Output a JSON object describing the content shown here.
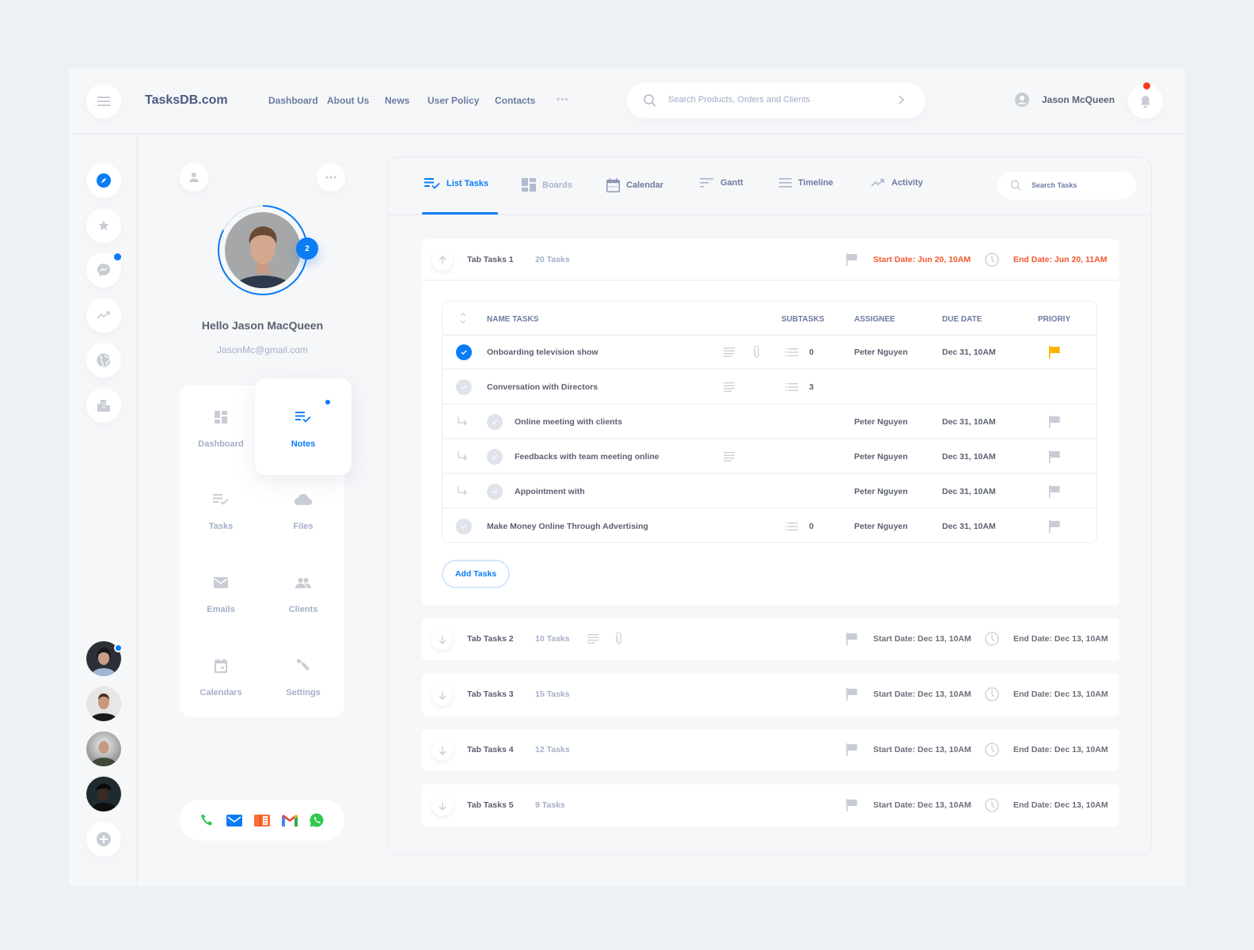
{
  "header": {
    "logo": "TasksDB.com",
    "nav": [
      "Dashboard",
      "About Us",
      "News",
      "User Policy",
      "Contacts"
    ],
    "more_label": "•••",
    "search_placeholder": "Search Products, Orders and Clients",
    "user_name": "Jason McQueen"
  },
  "profile": {
    "greeting": "Hello Jason MacQueen",
    "email": "JasonMc@gmail.com",
    "notification_count": "2",
    "menu": [
      {
        "label": "Dashboard",
        "icon": "dashboard-icon"
      },
      {
        "label": "Notes",
        "icon": "notes-icon",
        "active": true
      },
      {
        "label": "Tasks",
        "icon": "tasks-icon"
      },
      {
        "label": "Files",
        "icon": "cloud-icon"
      },
      {
        "label": "Emails",
        "icon": "mail-icon"
      },
      {
        "label": "Clients",
        "icon": "people-icon"
      },
      {
        "label": "Calendars",
        "icon": "calendar-icon"
      },
      {
        "label": "Settings",
        "icon": "wrench-icon"
      }
    ],
    "contacts": [
      "phone-icon",
      "mail-icon",
      "contacts-book-icon",
      "gmail-icon",
      "whatsapp-icon"
    ]
  },
  "rail": {
    "icons": [
      "compass-icon",
      "star-icon",
      "messenger-icon",
      "trending-icon",
      "globe-icon",
      "city-icon"
    ]
  },
  "tabs": {
    "items": [
      "List Tasks",
      "Boards",
      "Calendar",
      "Gantt",
      "Timeline",
      "Activity"
    ],
    "active": "List Tasks",
    "search_placeholder": "Search Tasks"
  },
  "groups": [
    {
      "name": "Tab Tasks 1",
      "count": "20 Tasks",
      "start": "Start Date: Jun 20, 10AM",
      "end": "End Date: Jun 20, 11AM",
      "open": true
    },
    {
      "name": "Tab Tasks 2",
      "count": "10 Tasks",
      "start": "Start Date: Dec 13, 10AM",
      "end": "End Date: Dec 13, 10AM"
    },
    {
      "name": "Tab Tasks 3",
      "count": "15 Tasks",
      "start": "Start Date: Dec 13, 10AM",
      "end": "End Date: Dec 13, 10AM"
    },
    {
      "name": "Tab Tasks 4",
      "count": "12 Tasks",
      "start": "Start Date: Dec 13, 10AM",
      "end": "End Date: Dec 13, 10AM"
    },
    {
      "name": "Tab Tasks 5",
      "count": "9 Tasks",
      "start": "Start Date: Dec 13, 10AM",
      "end": "End Date: Dec 13, 10AM"
    }
  ],
  "table": {
    "headers": {
      "name": "NAME TASKS",
      "subtasks": "SUBTASKS",
      "assignee": "ASSIGNEE",
      "due": "DUE DATE",
      "priority": "PRIORIY"
    },
    "rows": [
      {
        "name": "Onboarding television show",
        "done": true,
        "subtask": false,
        "notes": true,
        "attach": true,
        "subtasks": "0",
        "assignee": "Peter Nguyen",
        "due": "Dec 31, 10AM",
        "priority": "high"
      },
      {
        "name": "Conversation with Directors",
        "done": false,
        "subtask": false,
        "notes": true,
        "attach": false,
        "subtasks": "3",
        "assignee": "",
        "due": "",
        "priority": ""
      },
      {
        "name": "Online meeting with clients",
        "done": false,
        "subtask": true,
        "notes": false,
        "attach": false,
        "subtasks": "",
        "assignee": "Peter Nguyen",
        "due": "Dec 31, 10AM",
        "priority": "normal"
      },
      {
        "name": "Feedbacks with team meeting online",
        "done": false,
        "subtask": true,
        "notes": true,
        "attach": false,
        "subtasks": "",
        "assignee": "Peter Nguyen",
        "due": "Dec 31, 10AM",
        "priority": "normal"
      },
      {
        "name": "Appointment with",
        "done": false,
        "subtask": true,
        "notes": false,
        "attach": false,
        "subtasks": "",
        "assignee": "Peter Nguyen",
        "due": "Dec 31, 10AM",
        "priority": "normal"
      },
      {
        "name": "Make Money Online Through Advertising",
        "done": false,
        "subtask": false,
        "notes": false,
        "attach": false,
        "subtasks": "0",
        "assignee": "Peter Nguyen",
        "due": "Dec 31, 10AM",
        "priority": "normal"
      }
    ],
    "add_label": "Add Tasks"
  },
  "colors": {
    "accent": "#0a7cf5",
    "alert": "#f4572d",
    "priority_high": "#f8b400",
    "notification": "#f53d1e"
  }
}
